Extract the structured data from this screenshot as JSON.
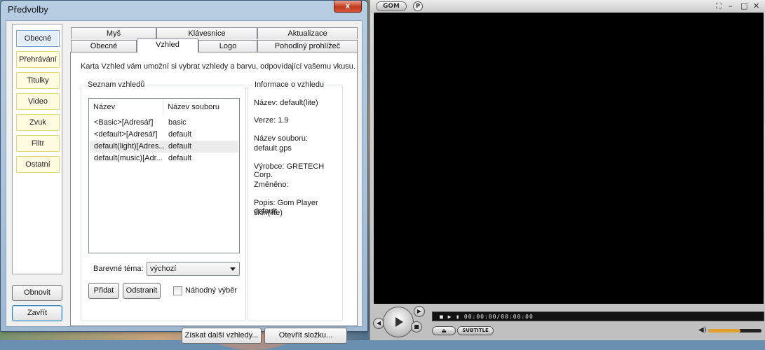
{
  "dialog": {
    "title": "Předvolby",
    "close": "x"
  },
  "sidebar": {
    "items": [
      {
        "label": "Obecné"
      },
      {
        "label": "Přehrávání"
      },
      {
        "label": "Titulky"
      },
      {
        "label": "Video"
      },
      {
        "label": "Zvuk"
      },
      {
        "label": "Filtr"
      },
      {
        "label": "Ostatní"
      }
    ],
    "active": "Obecné",
    "reset_label": "Obnovit",
    "close_label": "Zavřít"
  },
  "tabs": {
    "row1": [
      "Myš",
      "Klávesnice",
      "Aktualizace"
    ],
    "row2": [
      "Obecné",
      "Vzhled",
      "Logo",
      "Pohodlný prohlížeč"
    ],
    "active": "Vzhled"
  },
  "skin_tab": {
    "description": "Karta Vzhled vám umožní si vybrat vzhledy a barvu, odpovídající vašemu vkusu.",
    "list_group_title": "Seznam vzhledů",
    "columns": [
      "Název",
      "Název souboru"
    ],
    "rows": [
      {
        "name": "<Basic>[Adresář]",
        "file": "basic"
      },
      {
        "name": "<default>[Adresář]",
        "file": "default"
      },
      {
        "name": "default(light)[Adres...",
        "file": "default"
      },
      {
        "name": "default(music)[Adr...",
        "file": "default"
      }
    ],
    "selected_row": 2,
    "theme_label": "Barevné téma:",
    "theme_value": "výchozí",
    "add_label": "Přidat",
    "remove_label": "Odstranit",
    "random_label": "Náhodný výběr",
    "get_more_label": "Získat další vzhledy...",
    "open_folder_label": "Otevřít složku...",
    "info": {
      "title": "Informace o vzhledu",
      "name": "Název: default(lite)",
      "version": "Verze: 1.9",
      "file_line1": "Název souboru:",
      "file_line2": "default.gps",
      "maker": "Výrobce: GRETECH Corp.",
      "modified": "Změněno:",
      "desc_line1": "Popis: Gom Player default",
      "desc_line2": "skin(lite)"
    }
  },
  "player": {
    "logo": "GOM",
    "p_button": "P",
    "window_controls": [
      "⛶",
      "–",
      "□",
      "✕"
    ],
    "time": "■ ▶ ▮ 00:00:00/00:00:00",
    "eject": "⏏",
    "subtitle": "SUBTITLE",
    "volume": 0.6,
    "accent": "#e0a030"
  }
}
